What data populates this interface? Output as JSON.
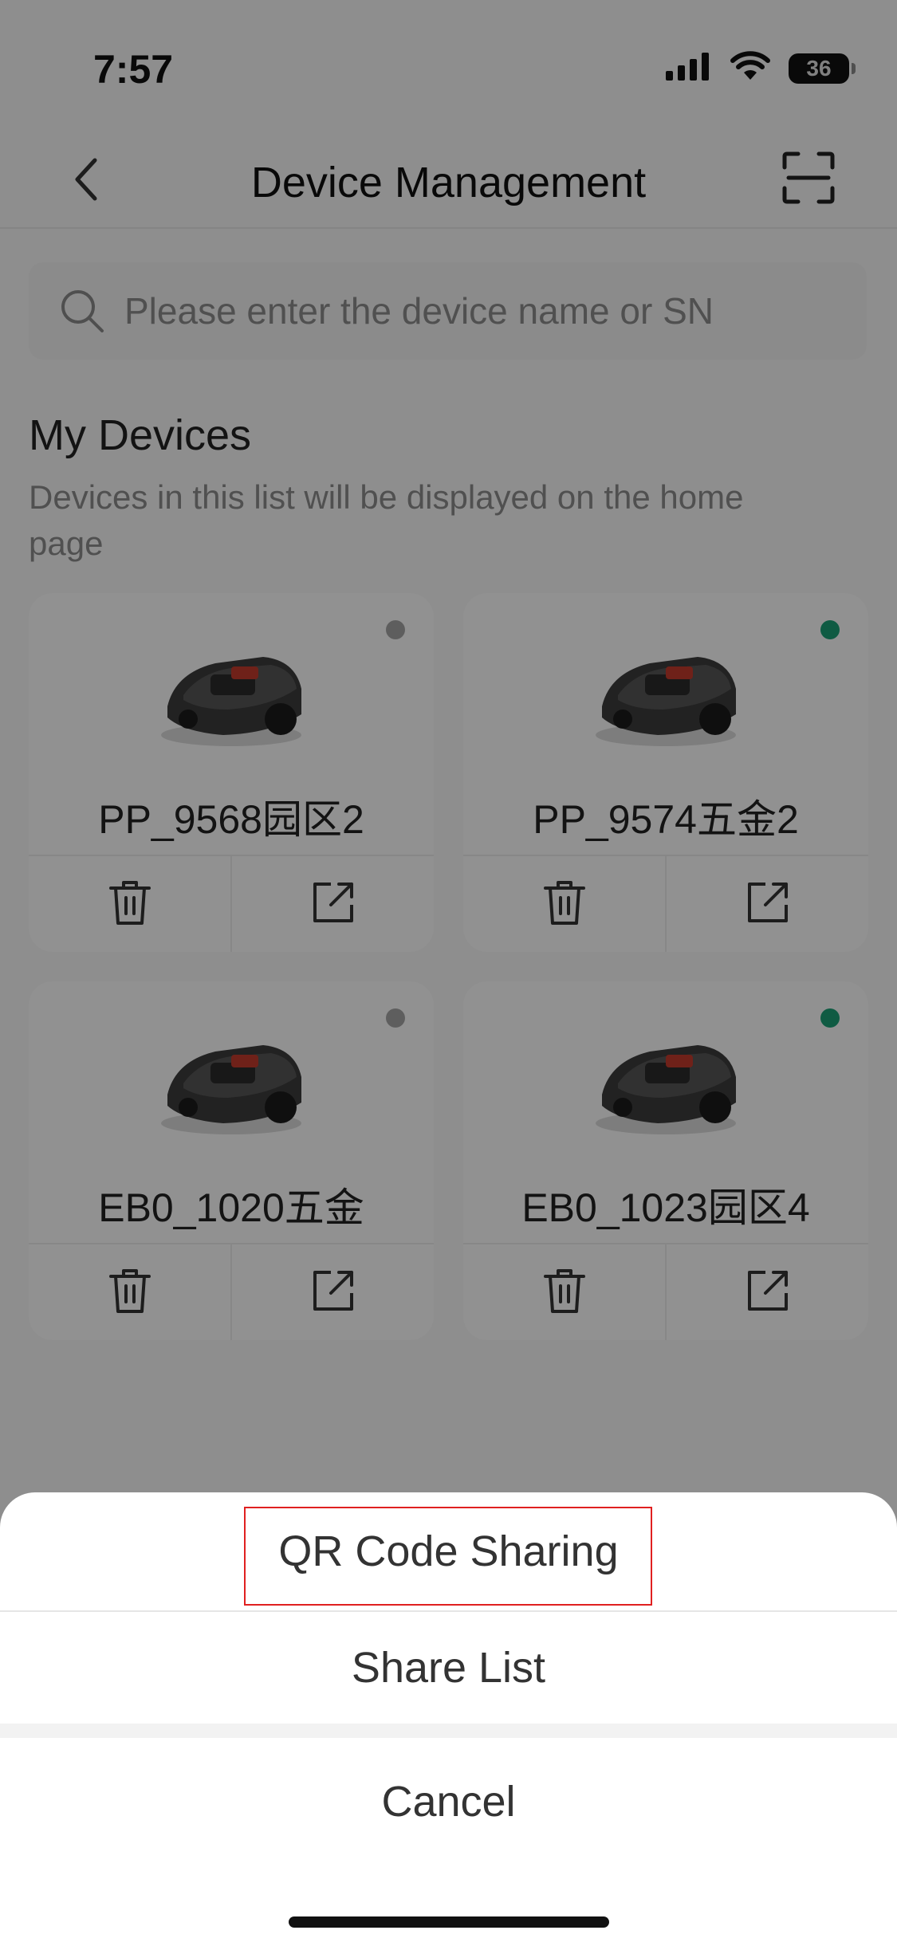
{
  "status_bar": {
    "time": "7:57",
    "battery": "36",
    "icons": [
      "cellular-signal-icon",
      "wifi-icon",
      "battery-icon"
    ]
  },
  "header": {
    "title": "Device Management",
    "back_icon": "chevron-left-icon",
    "scan_icon": "scan-icon"
  },
  "search": {
    "placeholder": "Please enter the device name or SN",
    "value": ""
  },
  "section": {
    "title": "My Devices",
    "description": "Devices in this list will be displayed on the home page"
  },
  "devices": [
    {
      "name": "PP_9568园区2",
      "status": "offline"
    },
    {
      "name": "PP_9574五金2",
      "status": "online"
    },
    {
      "name": "EB0_1020五金",
      "status": "offline"
    },
    {
      "name": "EB0_1023园区4",
      "status": "online"
    }
  ],
  "colors": {
    "online": "#1a9e74",
    "offline": "#a3a3a3",
    "highlight_frame": "#e02020"
  },
  "action_sheet": {
    "qr_sharing": "QR Code Sharing",
    "share_list": "Share List",
    "cancel": "Cancel"
  }
}
